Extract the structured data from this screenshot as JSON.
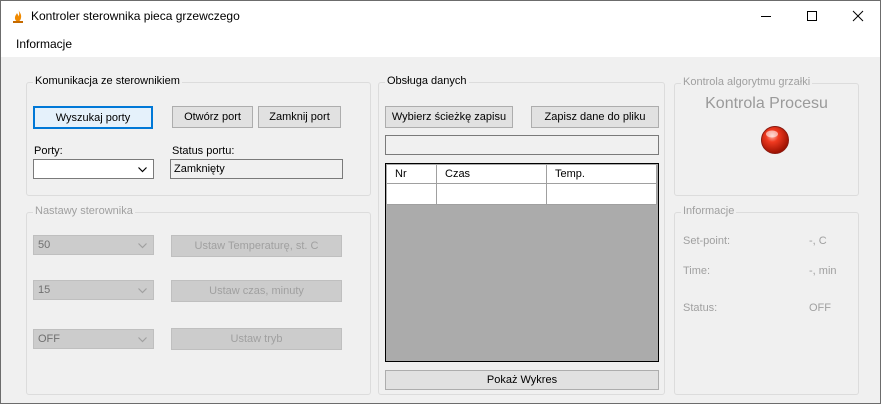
{
  "window": {
    "title": "Kontroler sterownika pieca grzewczego"
  },
  "menu": {
    "items": [
      "Informacje"
    ]
  },
  "communication": {
    "group_label": "Komunikacja ze sterownikiem",
    "search_ports_label": "Wyszukaj porty",
    "open_port_label": "Otwórz port",
    "close_port_label": "Zamknij port",
    "ports_label": "Porty:",
    "ports_value": "",
    "port_status_label": "Status portu:",
    "port_status_value": "Zamknięty"
  },
  "settings": {
    "group_label": "Nastawy sterownika",
    "temperature_value": "50",
    "temperature_button": "Ustaw Temperaturę, st. C",
    "time_value": "15",
    "time_button": "Ustaw czas, minuty",
    "mode_value": "OFF",
    "mode_button": "Ustaw tryb"
  },
  "data_handling": {
    "group_label": "Obsługa danych",
    "choose_path_label": "Wybierz ścieżkę zapisu",
    "save_data_label": "Zapisz dane do pliku",
    "path_value": "",
    "table_columns": [
      "Nr",
      "Czas",
      "Temp."
    ],
    "show_chart_label": "Pokaż Wykres"
  },
  "heater_control": {
    "group_label": "Kontrola algorytmu grzałki",
    "title": "Kontrola Procesu",
    "led_color": "#e02010"
  },
  "info": {
    "group_label": "Informacje",
    "setpoint_label": "Set-point:",
    "setpoint_value": "-, C",
    "time_label": "Time:",
    "time_value": "-, min",
    "status_label": "Status:",
    "status_value": "OFF"
  }
}
